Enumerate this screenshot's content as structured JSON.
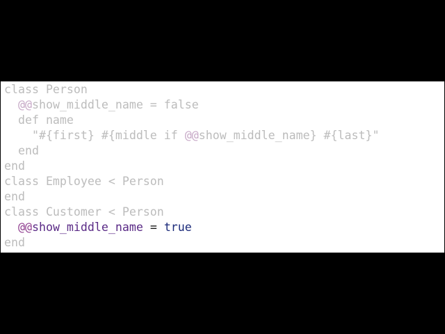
{
  "editor": {
    "colors": {
      "background": "#000000",
      "panel": "#ffffff",
      "dimmed_text": "#bcbcbc",
      "dimmed_symbol": "#c7a9c7",
      "highlight_symbol": "#8f3d8f",
      "highlight_name": "#5a2a86",
      "highlight_operator": "#1a1a1a",
      "highlight_keyword": "#1b2a7a"
    },
    "lines": [
      {
        "state": "dimmed",
        "tokens": [
          {
            "text": "class Person",
            "style": "dim"
          }
        ]
      },
      {
        "state": "dimmed",
        "tokens": [
          {
            "text": "  ",
            "style": "dim"
          },
          {
            "text": "@@",
            "style": "dim-sym"
          },
          {
            "text": "show_middle_name = false",
            "style": "dim"
          }
        ]
      },
      {
        "state": "dimmed",
        "tokens": [
          {
            "text": "  def name",
            "style": "dim"
          }
        ]
      },
      {
        "state": "dimmed",
        "tokens": [
          {
            "text": "    \"#{first} #{middle if ",
            "style": "dim"
          },
          {
            "text": "@@",
            "style": "dim-sym"
          },
          {
            "text": "show_middle_name} #{last}\"",
            "style": "dim"
          }
        ]
      },
      {
        "state": "dimmed",
        "tokens": [
          {
            "text": "  end",
            "style": "dim"
          }
        ]
      },
      {
        "state": "dimmed",
        "tokens": [
          {
            "text": "end",
            "style": "dim"
          }
        ]
      },
      {
        "state": "dimmed",
        "tokens": [
          {
            "text": "class Employee < Person",
            "style": "dim"
          }
        ]
      },
      {
        "state": "dimmed",
        "tokens": [
          {
            "text": "end",
            "style": "dim"
          }
        ]
      },
      {
        "state": "dimmed",
        "tokens": [
          {
            "text": "class Customer < Person",
            "style": "dim"
          }
        ]
      },
      {
        "state": "highlighted",
        "tokens": [
          {
            "text": "  ",
            "style": "hl-op"
          },
          {
            "text": "@@",
            "style": "hl-sym"
          },
          {
            "text": "show_middle_name",
            "style": "hl-name"
          },
          {
            "text": " = ",
            "style": "hl-op"
          },
          {
            "text": "true",
            "style": "hl-kw"
          }
        ]
      },
      {
        "state": "dimmed",
        "tokens": [
          {
            "text": "end",
            "style": "dim"
          }
        ]
      }
    ]
  }
}
